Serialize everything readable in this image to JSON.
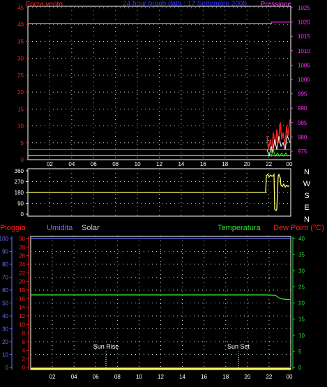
{
  "colors": {
    "wind": "#ff2020",
    "pressure": "#ff30ff",
    "humidity": "#7070ff",
    "temperature": "#30e030",
    "rain": "#ff2020",
    "direction": "#ffff60",
    "white": "#ffffff",
    "grid": "#cfcfcf",
    "title": "#3030ff",
    "solar": "#c8c8c8",
    "sun_marker": "#ffffff"
  },
  "top": {
    "title": "24 hour graph data : 17 Settembre 2008",
    "left_label": "Forza vento",
    "right_label": "Pressione",
    "left_ticks": [
      "45",
      "40",
      "35",
      "30",
      "25",
      "20",
      "15",
      "10",
      "5",
      "0"
    ],
    "right_ticks": [
      "1025",
      "1020",
      "1015",
      "1010",
      "1005",
      "1000",
      "995",
      "990",
      "985",
      "980",
      "975"
    ]
  },
  "middle": {
    "left_ticks": [
      "360",
      "270",
      "180",
      "90",
      "0"
    ],
    "compass": [
      "N",
      "W",
      "S",
      "E",
      "N"
    ]
  },
  "bottom": {
    "rain_label": "Pioggia",
    "humidity_label": "Umidita",
    "solar_label": "Solar",
    "temperature_label": "Temperatura",
    "dew_label": "Dew Point (°C)",
    "humidity_ticks": [
      "100",
      "90",
      "80",
      "70",
      "60",
      "50",
      "40",
      "30",
      "20",
      "10",
      "0"
    ],
    "rain_ticks": [
      "30",
      "28",
      "26",
      "24",
      "22",
      "20",
      "18",
      "16",
      "14",
      "12",
      "10",
      "8",
      "6",
      "4",
      "2",
      "0"
    ],
    "temp_ticks": [
      "40",
      "35",
      "30",
      "25",
      "20",
      "15",
      "10",
      "5",
      "0"
    ],
    "sun_rise": "Sun Rise",
    "sun_set": "Sun Set"
  },
  "x_ticks": [
    "02",
    "04",
    "06",
    "08",
    "10",
    "12",
    "14",
    "16",
    "18",
    "20",
    "22",
    "00"
  ],
  "x_ticks_bottom": [
    "02",
    "04",
    "06",
    "08",
    "10",
    "12",
    "14",
    "16",
    "18",
    "20",
    "22",
    "00"
  ],
  "chart_data": [
    {
      "type": "line",
      "title": "24 hour graph data : 17 Settembre 2008",
      "ylabel": "Forza vento",
      "y2label": "Pressione",
      "ylim": [
        0,
        45
      ],
      "y2lim": [
        975,
        1025
      ],
      "x": [
        "02",
        "04",
        "06",
        "08",
        "10",
        "12",
        "14",
        "16",
        "18",
        "20",
        "22",
        "00"
      ],
      "series": [
        {
          "name": "Pressione",
          "axis": "right",
          "values": [
            1019.5,
            1019.5,
            1019.5,
            1019.5,
            1019.5,
            1019.5,
            1019.5,
            1019.5,
            1019.5,
            1019.5,
            1019.5,
            1020
          ]
        },
        {
          "name": "Forza vento",
          "axis": "left",
          "values": [
            3,
            3,
            3,
            3,
            3,
            3,
            3,
            3,
            3,
            3,
            3,
            5
          ]
        }
      ]
    },
    {
      "type": "line",
      "ylim": [
        0,
        360
      ],
      "x": [
        "02",
        "04",
        "06",
        "08",
        "10",
        "12",
        "14",
        "16",
        "18",
        "20",
        "22",
        "00"
      ],
      "series": [
        {
          "values": [
            180,
            180,
            180,
            180,
            180,
            180,
            180,
            180,
            180,
            180,
            320,
            230
          ]
        }
      ]
    },
    {
      "type": "line",
      "ylabel": "Umidita",
      "y2label": "Temperatura",
      "ylim": [
        0,
        100
      ],
      "y2lim": [
        0,
        40
      ],
      "x": [
        "02",
        "04",
        "06",
        "08",
        "10",
        "12",
        "14",
        "16",
        "18",
        "20",
        "22",
        "00"
      ],
      "series": [
        {
          "name": "Temperatura",
          "axis": "right",
          "values": [
            22.5,
            22.5,
            22.5,
            22.5,
            22.5,
            22.5,
            22.5,
            22.5,
            22.5,
            22.5,
            22.5,
            21
          ]
        },
        {
          "name": "Umidita",
          "axis": "left",
          "values": [
            100,
            100,
            100,
            100,
            100,
            100,
            100,
            100,
            100,
            100,
            100,
            100
          ]
        },
        {
          "name": "Pioggia",
          "axis": "left",
          "values": [
            0,
            0,
            0,
            0,
            0,
            0,
            0,
            0,
            0,
            0,
            0,
            0
          ]
        }
      ]
    }
  ]
}
